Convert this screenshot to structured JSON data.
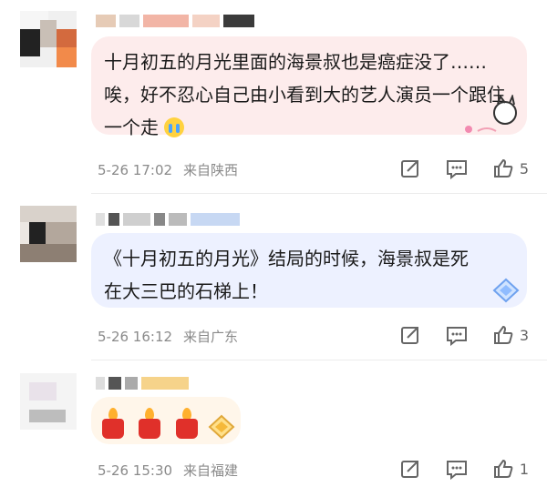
{
  "comments": [
    {
      "text": "十月初五的月光里面的海景叔也是癌症没了……唉，好不忍心自己由小看到大的艺人演员一个跟住一个走",
      "emoji": "crying-face",
      "date": "5-26 17:02",
      "location": "来自陕西",
      "likes": "5",
      "bubble_color": "#fdecec"
    },
    {
      "text": "《十月初五的月光》结局的时候，海景叔是死在大三巴的石梯上！",
      "date": "5-26 16:12",
      "location": "来自广东",
      "likes": "3",
      "bubble_color": "#edf1ff"
    },
    {
      "date": "5-26 15:30",
      "location": "来自福建",
      "likes": "1",
      "bubble_color": "#fff6ea"
    }
  ]
}
